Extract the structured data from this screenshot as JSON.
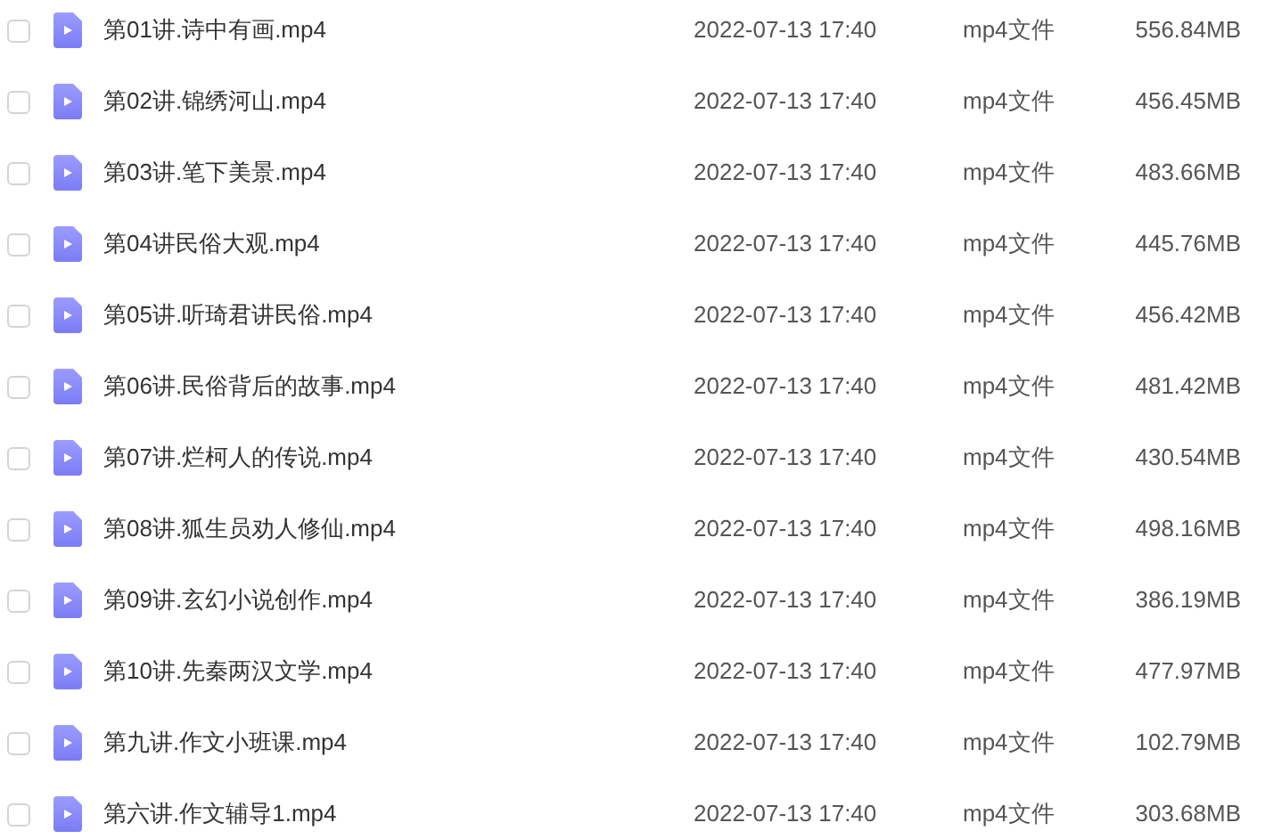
{
  "files": [
    {
      "name": "第01讲.诗中有画.mp4",
      "modified": "2022-07-13 17:40",
      "type": "mp4文件",
      "size": "556.84MB",
      "checked": false
    },
    {
      "name": "第02讲.锦绣河山.mp4",
      "modified": "2022-07-13 17:40",
      "type": "mp4文件",
      "size": "456.45MB",
      "checked": false
    },
    {
      "name": "第03讲.笔下美景.mp4",
      "modified": "2022-07-13 17:40",
      "type": "mp4文件",
      "size": "483.66MB",
      "checked": false
    },
    {
      "name": "第04讲民俗大观.mp4",
      "modified": "2022-07-13 17:40",
      "type": "mp4文件",
      "size": "445.76MB",
      "checked": false
    },
    {
      "name": "第05讲.听琦君讲民俗.mp4",
      "modified": "2022-07-13 17:40",
      "type": "mp4文件",
      "size": "456.42MB",
      "checked": false
    },
    {
      "name": "第06讲.民俗背后的故事.mp4",
      "modified": "2022-07-13 17:40",
      "type": "mp4文件",
      "size": "481.42MB",
      "checked": false
    },
    {
      "name": "第07讲.烂柯人的传说.mp4",
      "modified": "2022-07-13 17:40",
      "type": "mp4文件",
      "size": "430.54MB",
      "checked": false
    },
    {
      "name": "第08讲.狐生员劝人修仙.mp4",
      "modified": "2022-07-13 17:40",
      "type": "mp4文件",
      "size": "498.16MB",
      "checked": false
    },
    {
      "name": "第09讲.玄幻小说创作.mp4",
      "modified": "2022-07-13 17:40",
      "type": "mp4文件",
      "size": "386.19MB",
      "checked": false
    },
    {
      "name": "第10讲.先秦两汉文学.mp4",
      "modified": "2022-07-13 17:40",
      "type": "mp4文件",
      "size": "477.97MB",
      "checked": false
    },
    {
      "name": "第九讲.作文小班课.mp4",
      "modified": "2022-07-13 17:40",
      "type": "mp4文件",
      "size": "102.79MB",
      "checked": false
    },
    {
      "name": "第六讲.作文辅导1.mp4",
      "modified": "2022-07-13 17:40",
      "type": "mp4文件",
      "size": "303.68MB",
      "checked": false
    }
  ]
}
